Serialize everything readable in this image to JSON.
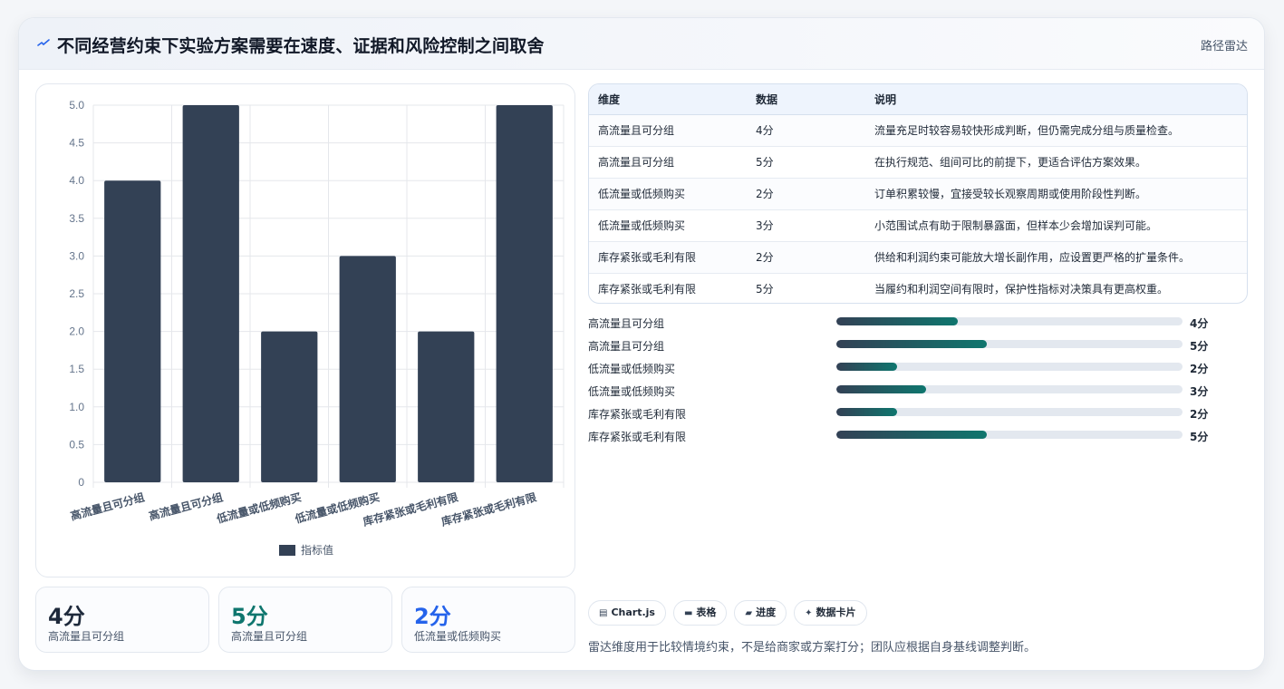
{
  "header": {
    "title": "不同经营约束下实验方案需要在速度、证据和风险控制之间取舍",
    "tag": "路径雷达",
    "icon": "lightning-icon"
  },
  "chart_data": {
    "type": "bar",
    "categories": [
      "高流量且可分组",
      "高流量且可分组",
      "低流量或低频购买",
      "低流量或低频购买",
      "库存紧张或毛利有限",
      "库存紧张或毛利有限"
    ],
    "series": [
      {
        "name": "指标值",
        "values": [
          4,
          5,
          2,
          3,
          2,
          5
        ]
      }
    ],
    "ylim": [
      0,
      5
    ],
    "yticks": [
      "0",
      "0.5",
      "1.0",
      "1.5",
      "2.0",
      "2.5",
      "3.0",
      "3.5",
      "4.0",
      "4.5",
      "5.0"
    ],
    "grid": true,
    "legend": "bottom",
    "bar_color": "#334155"
  },
  "stats": [
    {
      "value": "4分",
      "label": "高流量且可分组",
      "color": "#1e293b"
    },
    {
      "value": "5分",
      "label": "高流量且可分组",
      "color": "#0f766e"
    },
    {
      "value": "2分",
      "label": "低流量或低频购买",
      "color": "#2563eb"
    }
  ],
  "table": {
    "headers": [
      "维度",
      "数据",
      "说明"
    ],
    "rows": [
      [
        "高流量且可分组",
        "4分",
        "流量充足时较容易较快形成判断，但仍需完成分组与质量检查。"
      ],
      [
        "高流量且可分组",
        "5分",
        "在执行规范、组间可比的前提下，更适合评估方案效果。"
      ],
      [
        "低流量或低频购买",
        "2分",
        "订单积累较慢，宜接受较长观察周期或使用阶段性判断。"
      ],
      [
        "低流量或低频购买",
        "3分",
        "小范围试点有助于限制暴露面，但样本少会增加误判可能。"
      ],
      [
        "库存紧张或毛利有限",
        "2分",
        "供给和利润约束可能放大增长副作用，应设置更严格的扩量条件。"
      ],
      [
        "库存紧张或毛利有限",
        "5分",
        "当履约和利润空间有限时，保护性指标对决策具有更高权重。"
      ]
    ]
  },
  "progress": [
    {
      "label": "高流量且可分组",
      "value": "4分",
      "fraction": 0.35
    },
    {
      "label": "高流量且可分组",
      "value": "5分",
      "fraction": 0.435
    },
    {
      "label": "低流量或低频购买",
      "value": "2分",
      "fraction": 0.175
    },
    {
      "label": "低流量或低频购买",
      "value": "3分",
      "fraction": 0.26
    },
    {
      "label": "库存紧张或毛利有限",
      "value": "2分",
      "fraction": 0.175
    },
    {
      "label": "库存紧张或毛利有限",
      "value": "5分",
      "fraction": 0.435
    }
  ],
  "pills": [
    {
      "icon": "chart-icon",
      "glyph": "▤",
      "label": "Chart.js"
    },
    {
      "icon": "table-icon",
      "glyph": "▬",
      "label": "表格"
    },
    {
      "icon": "progress-icon",
      "glyph": "▰",
      "label": "进度"
    },
    {
      "icon": "sparkle-icon",
      "glyph": "✦",
      "label": "数据卡片"
    }
  ],
  "footnote": "雷达维度用于比较情境约束，不是给商家或方案打分；团队应根据自身基线调整判断。"
}
